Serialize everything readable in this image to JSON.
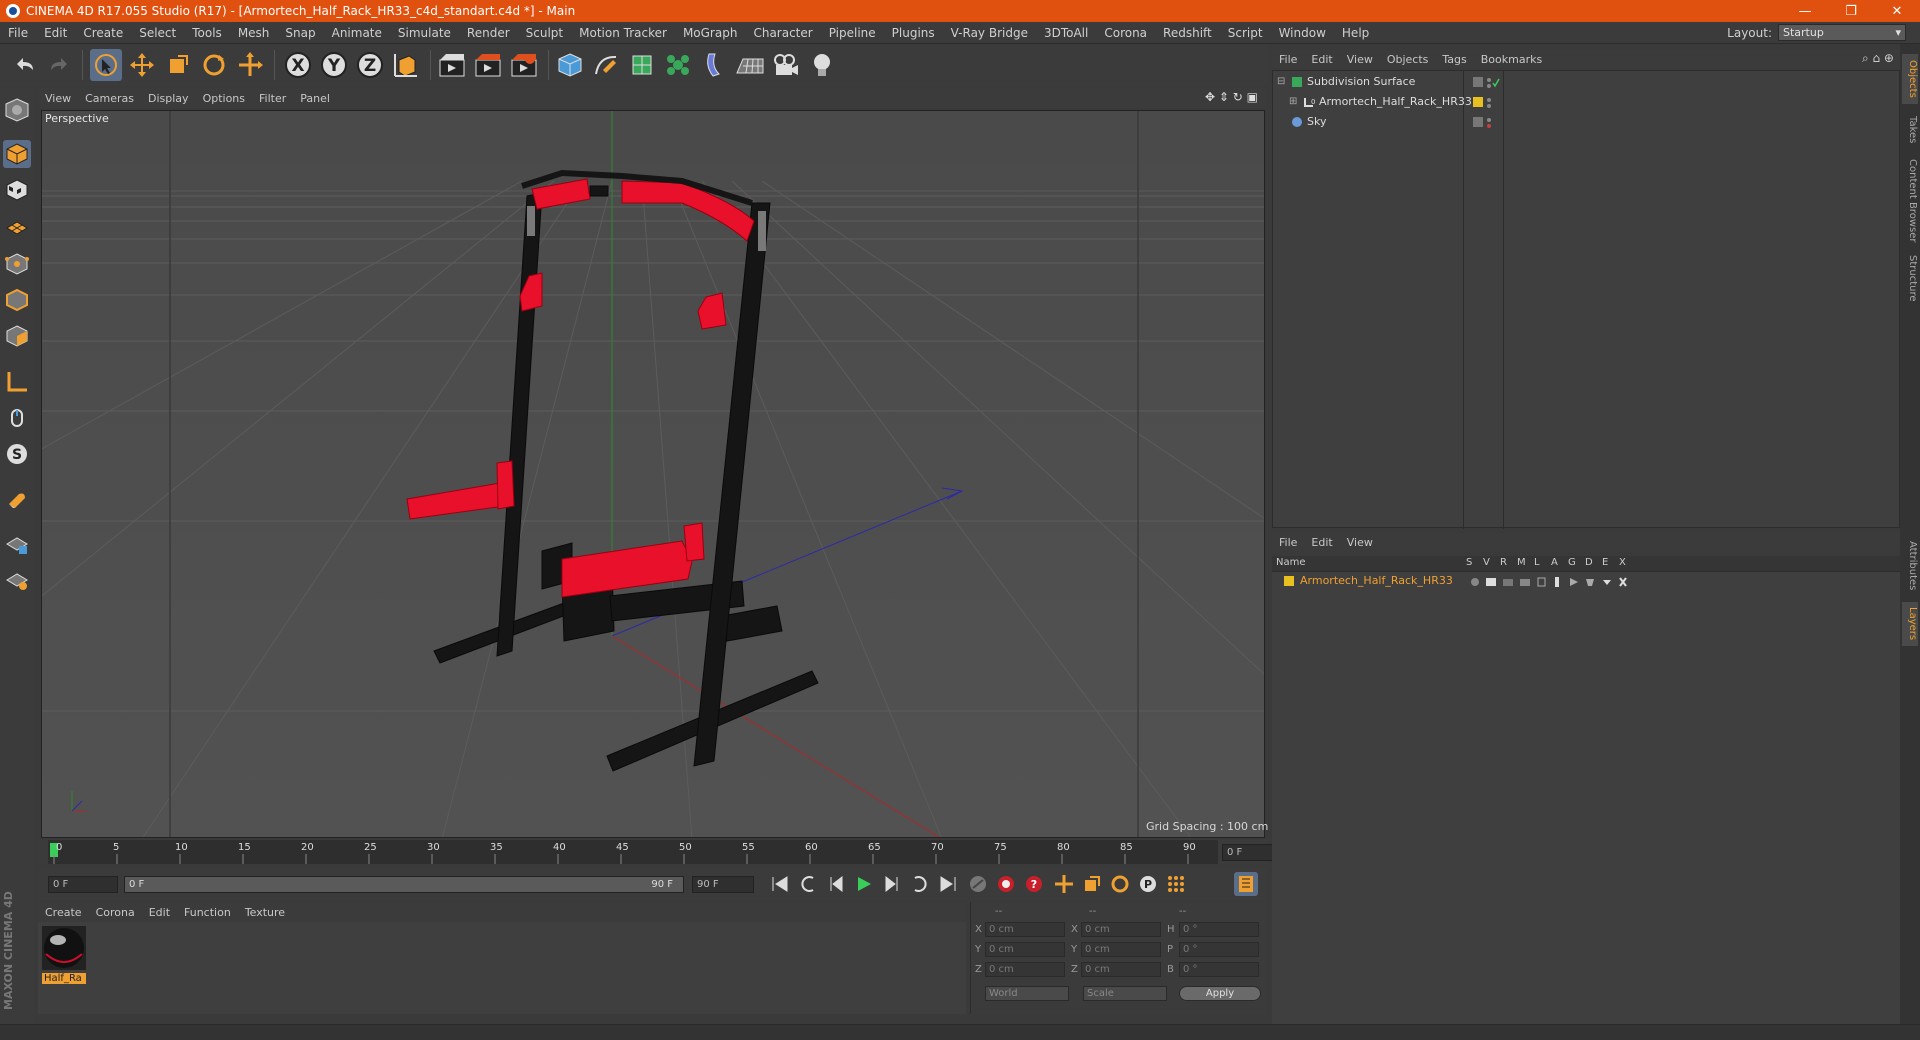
{
  "window": {
    "title": "CINEMA 4D R17.055 Studio (R17) - [Armortech_Half_Rack_HR33_c4d_standart.c4d *] - Main",
    "minimize": "—",
    "restore": "❐",
    "close": "✕"
  },
  "menu": [
    "File",
    "Edit",
    "Create",
    "Select",
    "Tools",
    "Mesh",
    "Snap",
    "Animate",
    "Simulate",
    "Render",
    "Sculpt",
    "Motion Tracker",
    "MoGraph",
    "Character",
    "Pipeline",
    "Plugins",
    "V-Ray Bridge",
    "3DToAll",
    "Corona",
    "Redshift",
    "Script",
    "Window",
    "Help"
  ],
  "layout": {
    "label": "Layout:",
    "value": "Startup"
  },
  "viewport": {
    "menu": [
      "View",
      "Cameras",
      "Display",
      "Options",
      "Filter",
      "Panel"
    ],
    "label": "Perspective",
    "grid_spacing": "Grid Spacing : 100 cm"
  },
  "timeline": {
    "ticks": [
      "0",
      "5",
      "10",
      "15",
      "20",
      "25",
      "30",
      "35",
      "40",
      "45",
      "50",
      "55",
      "60",
      "65",
      "70",
      "75",
      "80",
      "85",
      "90"
    ],
    "current_frame": "0 F",
    "start_field": "0 F",
    "range_start": "0 F",
    "range_end": "90 F",
    "end_field": "90 F"
  },
  "material_manager": {
    "menu": [
      "Create",
      "Corona",
      "Edit",
      "Function",
      "Texture"
    ],
    "materials": [
      {
        "name": "Half_Ra"
      }
    ]
  },
  "coordinates": {
    "headers": [
      "--",
      "--",
      "--"
    ],
    "rows": [
      {
        "a": "X",
        "av": "0 cm",
        "b": "X",
        "bv": "0 cm",
        "c": "H",
        "cv": "0 °"
      },
      {
        "a": "Y",
        "av": "0 cm",
        "b": "Y",
        "bv": "0 cm",
        "c": "P",
        "cv": "0 °"
      },
      {
        "a": "Z",
        "av": "0 cm",
        "b": "Z",
        "bv": "0 cm",
        "c": "B",
        "cv": "0 °"
      }
    ],
    "space": "World",
    "mode": "Scale",
    "apply": "Apply"
  },
  "object_manager": {
    "menu": [
      "File",
      "Edit",
      "View",
      "Objects",
      "Tags",
      "Bookmarks"
    ],
    "objects": [
      {
        "name": "Subdivision Surface"
      },
      {
        "name": "Armortech_Half_Rack_HR33"
      },
      {
        "name": "Sky"
      }
    ]
  },
  "layer_manager": {
    "menu": [
      "File",
      "Edit",
      "View"
    ],
    "columns": [
      "Name",
      "S",
      "V",
      "R",
      "M",
      "L",
      "A",
      "G",
      "D",
      "E",
      "X"
    ],
    "layers": [
      {
        "name": "Armortech_Half_Rack_HR33",
        "color": "#e8c020"
      }
    ]
  },
  "right_tabs": [
    "Objects",
    "Takes",
    "Content Browser",
    "Structure",
    "Attributes",
    "Layers"
  ],
  "branding": "MAXON CINEMA 4D",
  "colors": {
    "titlebar": "#e0500f",
    "rack_red": "#e8102a",
    "selected": "#5a6e8a",
    "accent_orange": "#f09020"
  }
}
